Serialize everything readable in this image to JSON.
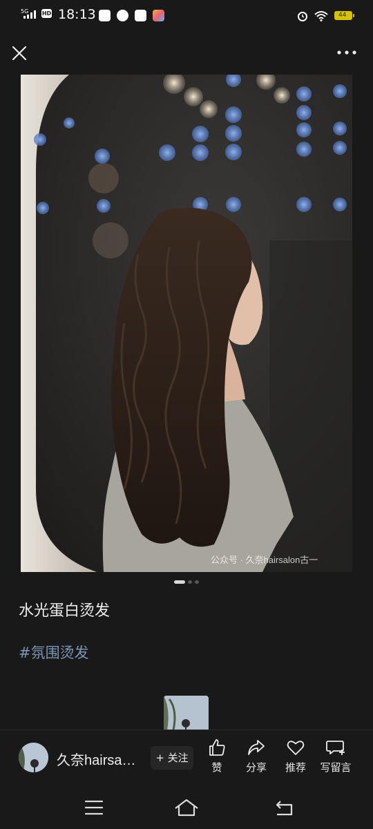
{
  "status_bar": {
    "network": "5G",
    "hd_label": "HD",
    "time": "18:13",
    "battery": "44",
    "icons": [
      "signal-icon",
      "hd-icon",
      "app-icon-1",
      "app-icon-2",
      "app-icon-3",
      "app-icon-4",
      "alarm-icon",
      "wifi-icon",
      "battery-icon"
    ]
  },
  "nav": {
    "close_icon": "close-icon",
    "more_icon": "more-dots-icon"
  },
  "post": {
    "watermark": "公众号 · 久奈hairsalon古一",
    "title": "水光蛋白烫发",
    "hashtag": "#氛围烫发",
    "image_count": 3,
    "active_image": 1
  },
  "author": {
    "name": "久奈hairsa…",
    "follow_label": "+ 关注"
  },
  "actions": [
    {
      "label": "赞",
      "icon": "thumb-up-icon"
    },
    {
      "label": "分享",
      "icon": "share-icon"
    },
    {
      "label": "推荐",
      "icon": "heart-icon"
    },
    {
      "label": "写留言",
      "icon": "comment-icon"
    }
  ],
  "system_nav": [
    "menu-icon",
    "home-icon",
    "back-icon"
  ],
  "colors": {
    "background": "#191919",
    "hashtag": "#7b97b8",
    "battery": "#d8c100"
  }
}
